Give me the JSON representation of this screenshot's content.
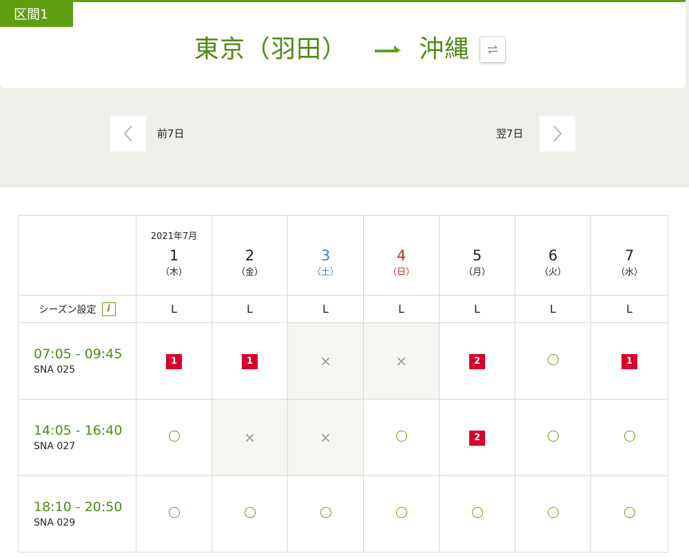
{
  "section": {
    "label": "区間1"
  },
  "route": {
    "origin": "東京（羽田）",
    "destination": "沖縄"
  },
  "pager": {
    "prev_label": "前7日",
    "next_label": "翌7日"
  },
  "table": {
    "month_label": "2021年7月",
    "days": [
      {
        "day": "1",
        "weekday": "（木）",
        "type": "weekday"
      },
      {
        "day": "2",
        "weekday": "（金）",
        "type": "weekday"
      },
      {
        "day": "3",
        "weekday": "（土）",
        "type": "saturday"
      },
      {
        "day": "4",
        "weekday": "（日）",
        "type": "sunday"
      },
      {
        "day": "5",
        "weekday": "（月）",
        "type": "weekday"
      },
      {
        "day": "6",
        "weekday": "（火）",
        "type": "weekday"
      },
      {
        "day": "7",
        "weekday": "（水）",
        "type": "weekday"
      }
    ],
    "season_label": "シーズン設定",
    "season_values": [
      "L",
      "L",
      "L",
      "L",
      "L",
      "L",
      "L"
    ],
    "flights": [
      {
        "time": "07:05 - 09:45",
        "number": "SNA 025",
        "status": [
          {
            "type": "seats",
            "value": "1"
          },
          {
            "type": "seats",
            "value": "1"
          },
          {
            "type": "unavailable"
          },
          {
            "type": "unavailable"
          },
          {
            "type": "seats",
            "value": "2"
          },
          {
            "type": "available"
          },
          {
            "type": "seats",
            "value": "1"
          }
        ]
      },
      {
        "time": "14:05 - 16:40",
        "number": "SNA 027",
        "status": [
          {
            "type": "available"
          },
          {
            "type": "unavailable"
          },
          {
            "type": "unavailable"
          },
          {
            "type": "available"
          },
          {
            "type": "seats",
            "value": "2"
          },
          {
            "type": "available"
          },
          {
            "type": "available"
          }
        ]
      },
      {
        "time": "18:10 - 20:50",
        "number": "SNA 029",
        "status": [
          {
            "type": "available"
          },
          {
            "type": "available"
          },
          {
            "type": "available"
          },
          {
            "type": "available"
          },
          {
            "type": "available"
          },
          {
            "type": "available"
          },
          {
            "type": "available"
          }
        ]
      }
    ]
  },
  "colors": {
    "brand_green": "#5f9e10",
    "saturday_blue": "#3d7fc7",
    "sunday_red": "#d6232f",
    "seats_badge_red": "#d6002a"
  },
  "icons": {
    "route_arrow": "arrow-right-icon",
    "swap": "swap-icon",
    "prev": "chevron-left-icon",
    "next": "chevron-right-icon",
    "info": "info-icon",
    "available": "circle-icon",
    "unavailable": "cross-icon"
  }
}
